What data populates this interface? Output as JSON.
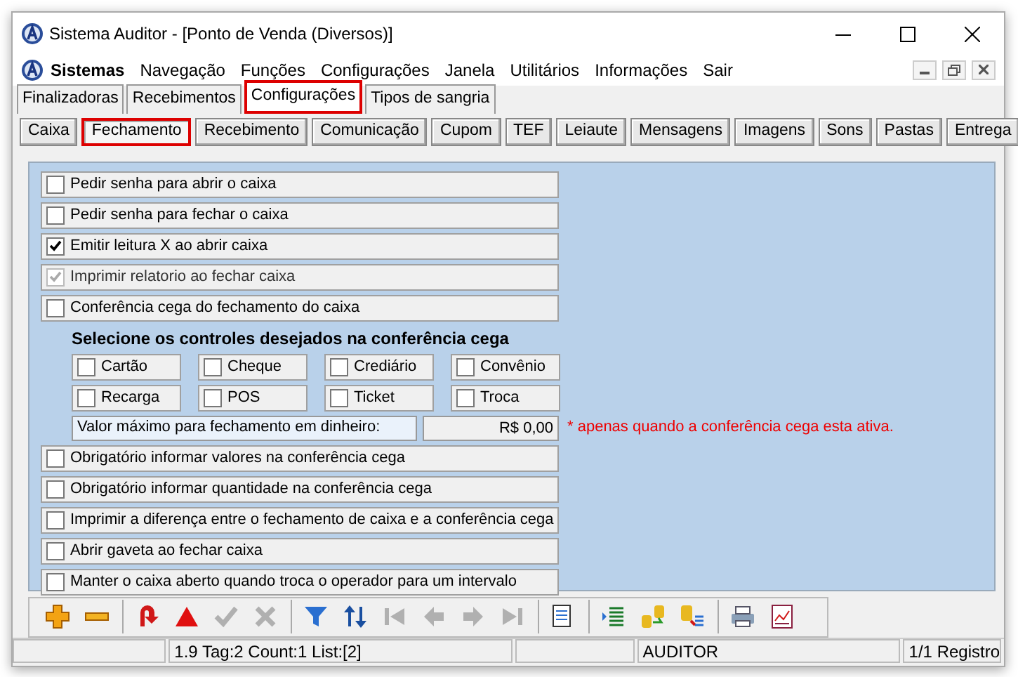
{
  "window": {
    "title": "Sistema Auditor - [Ponto de Venda (Diversos)]"
  },
  "menu": [
    "Sistemas",
    "Navegação",
    "Funções",
    "Configurações",
    "Janela",
    "Utilitários",
    "Informações",
    "Sair"
  ],
  "tabs": [
    {
      "label": "Finalizadoras",
      "selected": false,
      "highlighted": false
    },
    {
      "label": "Recebimentos",
      "selected": false,
      "highlighted": false
    },
    {
      "label": "Configurações",
      "selected": true,
      "highlighted": true
    },
    {
      "label": "Tipos de sangria",
      "selected": false,
      "highlighted": false
    }
  ],
  "subtabs": [
    {
      "label": "Caixa",
      "selected": false,
      "highlighted": false
    },
    {
      "label": "Fechamento",
      "selected": true,
      "highlighted": true
    },
    {
      "label": "Recebimento",
      "selected": false,
      "highlighted": false
    },
    {
      "label": "Comunicação",
      "selected": false,
      "highlighted": false
    },
    {
      "label": "Cupom",
      "selected": false,
      "highlighted": false
    },
    {
      "label": "TEF",
      "selected": false,
      "highlighted": false
    },
    {
      "label": "Leiaute",
      "selected": false,
      "highlighted": false
    },
    {
      "label": "Mensagens",
      "selected": false,
      "highlighted": false
    },
    {
      "label": "Imagens",
      "selected": false,
      "highlighted": false
    },
    {
      "label": "Sons",
      "selected": false,
      "highlighted": false
    },
    {
      "label": "Pastas",
      "selected": false,
      "highlighted": false
    },
    {
      "label": "Entrega",
      "selected": false,
      "highlighted": false
    }
  ],
  "options_top": [
    {
      "label": "Pedir senha para abrir o caixa",
      "checked": false,
      "disabled": false
    },
    {
      "label": "Pedir senha para fechar o caixa",
      "checked": false,
      "disabled": false
    },
    {
      "label": "Emitir leitura X ao abrir caixa",
      "checked": true,
      "disabled": false
    },
    {
      "label": "Imprimir relatorio ao fechar caixa",
      "checked": true,
      "disabled": true
    },
    {
      "label": "Conferência cega do fechamento do caixa",
      "checked": false,
      "disabled": false
    }
  ],
  "controls_heading": "Selecione os controles desejados na conferência cega",
  "controls": [
    {
      "label": "Cartão",
      "checked": false
    },
    {
      "label": "Cheque",
      "checked": false
    },
    {
      "label": "Crediário",
      "checked": false
    },
    {
      "label": "Convênio",
      "checked": false
    },
    {
      "label": "Recarga",
      "checked": false
    },
    {
      "label": "POS",
      "checked": false
    },
    {
      "label": "Ticket",
      "checked": false
    },
    {
      "label": "Troca",
      "checked": false
    }
  ],
  "max_value": {
    "label": "Valor máximo para fechamento em dinheiro:",
    "value": "R$ 0,00",
    "note": "* apenas quando a conferência cega esta ativa."
  },
  "options_bottom": [
    {
      "label": "Obrigatório informar valores na conferência cega",
      "checked": false,
      "disabled": false
    },
    {
      "label": "Obrigatório informar quantidade na conferência cega",
      "checked": false,
      "disabled": false
    },
    {
      "label": "Imprimir a diferença entre o fechamento de caixa e a conferência cega",
      "checked": false,
      "disabled": false
    },
    {
      "label": "Abrir gaveta ao fechar caixa",
      "checked": false,
      "disabled": false
    },
    {
      "label": "Manter o caixa aberto quando troca o operador para um intervalo",
      "checked": false,
      "disabled": false
    }
  ],
  "toolbar": [
    [
      {
        "kind": "add",
        "disabled": false
      },
      {
        "kind": "remove",
        "disabled": false
      }
    ],
    [
      {
        "kind": "undo",
        "disabled": false
      },
      {
        "kind": "warn",
        "disabled": false
      },
      {
        "kind": "confirm",
        "disabled": true
      },
      {
        "kind": "cancel",
        "disabled": true
      }
    ],
    [
      {
        "kind": "filter",
        "disabled": false
      },
      {
        "kind": "sort",
        "disabled": false
      },
      {
        "kind": "first",
        "disabled": true
      },
      {
        "kind": "prev",
        "disabled": true
      },
      {
        "kind": "next",
        "disabled": true
      },
      {
        "kind": "last",
        "disabled": true
      }
    ],
    [
      {
        "kind": "form",
        "disabled": false
      }
    ],
    [
      {
        "kind": "list",
        "disabled": false
      },
      {
        "kind": "swap",
        "disabled": false
      },
      {
        "kind": "query",
        "disabled": false
      }
    ],
    [
      {
        "kind": "print",
        "disabled": false
      },
      {
        "kind": "report",
        "disabled": false
      }
    ]
  ],
  "status_bar": [
    "1.9 Tag:2 Count:1 List:[2]",
    "AUDITOR",
    "1/1 Registro"
  ]
}
